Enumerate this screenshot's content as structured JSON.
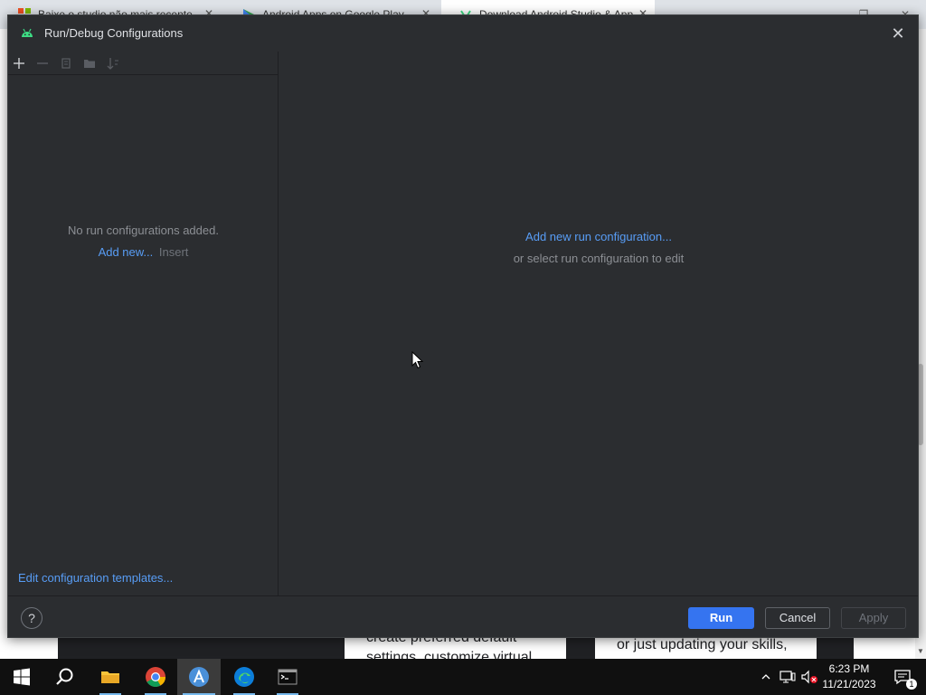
{
  "browser": {
    "tabs": [
      {
        "title": "Baixe o studio não mais recente"
      },
      {
        "title": "Android Apps on Google Play"
      },
      {
        "title": "Download Android Studio & App"
      }
    ],
    "page_cards": [
      {
        "text": "create preferred default settings, customize virtual"
      },
      {
        "text": "or just updating your skills,"
      }
    ]
  },
  "dialog": {
    "title": "Run/Debug Configurations",
    "icon": "android-icon",
    "toolbar": [
      {
        "icon": "plus-icon",
        "label": "Add New Configuration"
      },
      {
        "icon": "minus-icon",
        "label": "Remove Configuration"
      },
      {
        "icon": "copy-icon",
        "label": "Copy Configuration"
      },
      {
        "icon": "folder-icon",
        "label": "Move into new folder"
      },
      {
        "icon": "sort-icon",
        "label": "Sort configurations"
      }
    ],
    "left": {
      "empty_message": "No run configurations added.",
      "add_new_link": "Add new...",
      "add_new_shortcut": "Insert",
      "edit_templates_link": "Edit configuration templates..."
    },
    "right": {
      "add_config_link": "Add new run configuration...",
      "hint": "or select run configuration to edit"
    },
    "buttons": {
      "help": "?",
      "run": "Run",
      "cancel": "Cancel",
      "apply": "Apply"
    }
  },
  "taskbar": {
    "apps": [
      "windows-start",
      "search",
      "file-explorer",
      "chrome",
      "android-studio",
      "edge",
      "terminal"
    ],
    "tray_icons": [
      "chevron-up-icon",
      "network-icon",
      "volume-muted-icon"
    ],
    "time": "6:23 PM",
    "date": "11/21/2023",
    "notification_count": "1"
  },
  "colors": {
    "dialog_bg": "#2b2d30",
    "link": "#589df6",
    "primary_button": "#3574f0"
  }
}
